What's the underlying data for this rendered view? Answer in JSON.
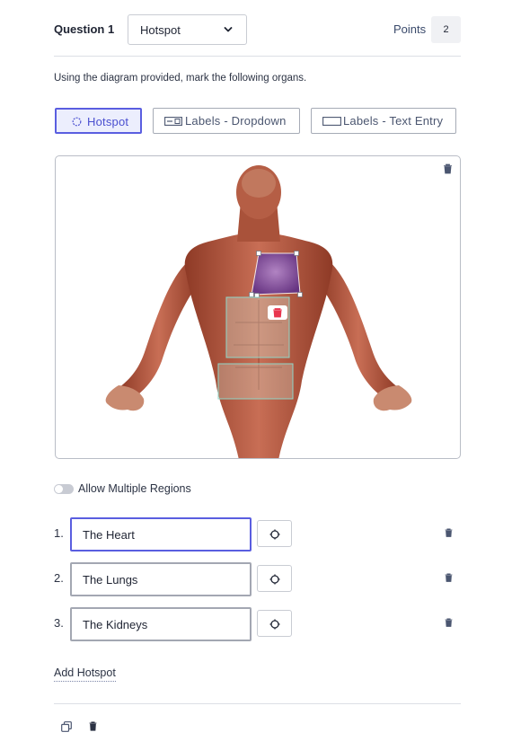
{
  "header": {
    "question_label": "Question 1",
    "type_select": {
      "value": "Hotspot",
      "icon": "chevron-down-icon"
    },
    "points_label": "Points",
    "points_value": "2"
  },
  "instruction": "Using the diagram provided, mark the following organs.",
  "modes": [
    {
      "label": "Hotspot",
      "icon": "hotspot-circle-icon",
      "active": true
    },
    {
      "label": "Labels - Dropdown",
      "icon": "dropdown-field-icon",
      "active": false
    },
    {
      "label": "Labels - Text Entry",
      "icon": "text-field-icon",
      "active": false
    }
  ],
  "canvas": {
    "image": "anatomical-muscle-figure",
    "regions": [
      "heart-region",
      "lungs-region",
      "kidneys-region"
    ],
    "accent": "#5a5ee0",
    "delete_color": "#e8364f"
  },
  "allow_multiple_regions": {
    "label": "Allow Multiple Regions",
    "enabled": false
  },
  "hotspots": [
    {
      "number": "1.",
      "value": "The Heart"
    },
    {
      "number": "2.",
      "value": "The Lungs"
    },
    {
      "number": "3.",
      "value": "The Kidneys"
    }
  ],
  "add_hotspot_label": "Add Hotspot",
  "footer": {
    "icons": [
      "copy-icon",
      "trash-icon"
    ]
  }
}
